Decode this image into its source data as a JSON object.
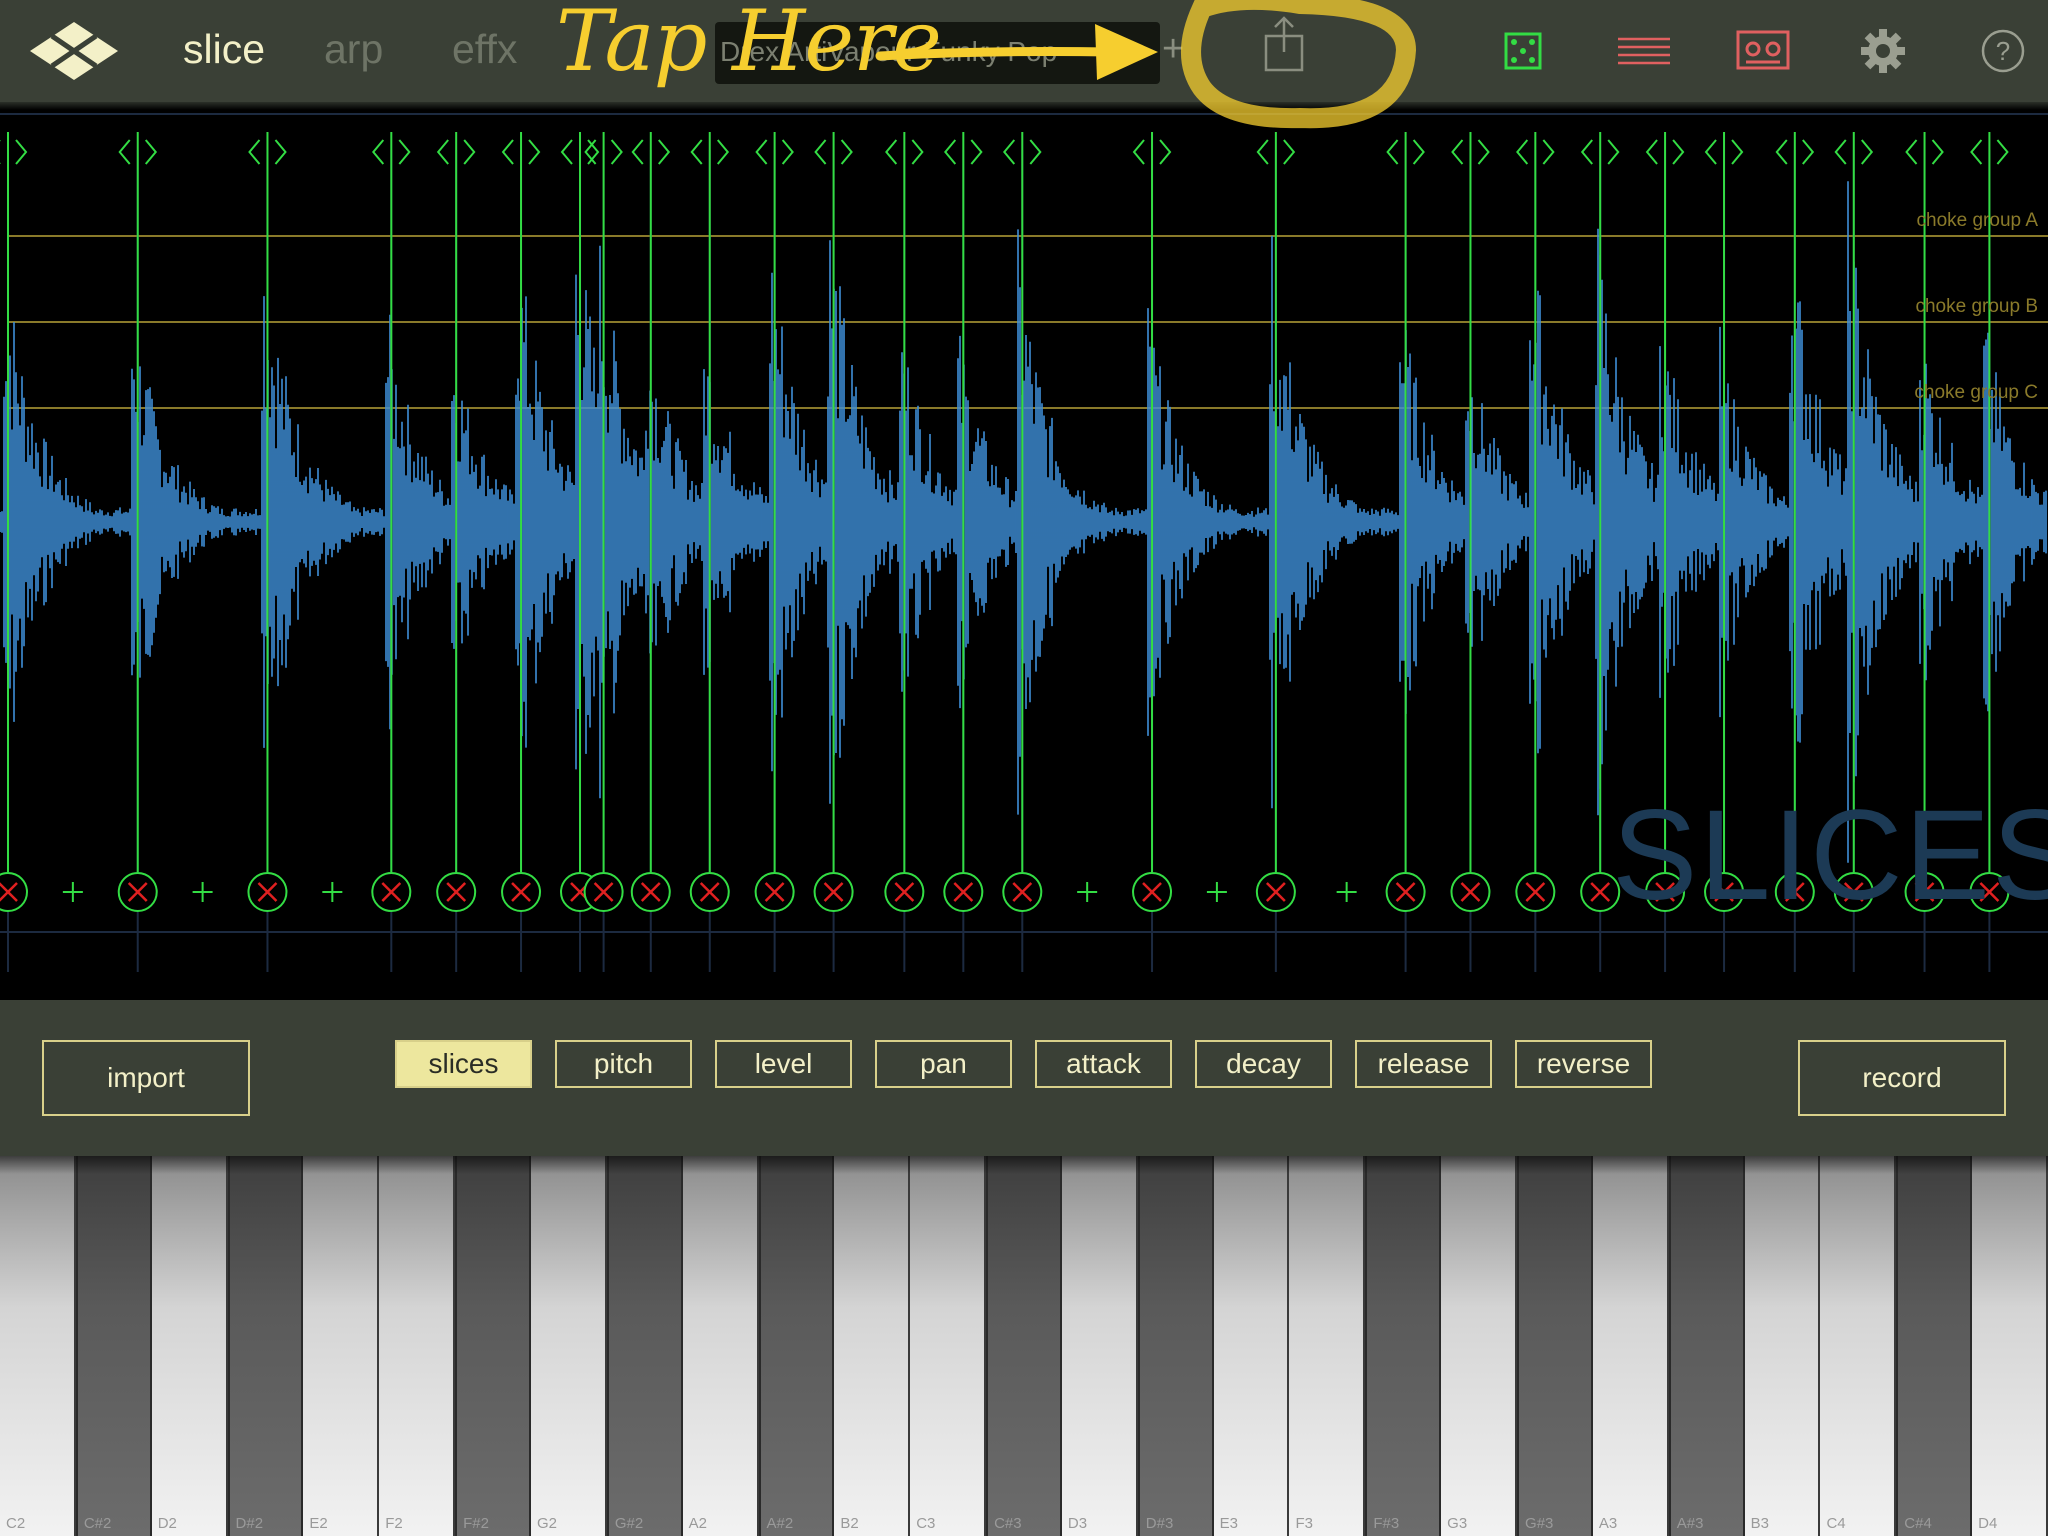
{
  "app": {
    "tabs": [
      {
        "label": "slice",
        "active": true
      },
      {
        "label": "arp",
        "active": false
      },
      {
        "label": "effx",
        "active": false
      }
    ],
    "preset_name": "Drex ArtiVapour Funky Pop",
    "preset_add_label": "+",
    "annotation": "Tap Here",
    "colors": {
      "panel_bg": "#3a4036",
      "accent_yellow": "#f6ce2f",
      "button_border": "#d8d08a",
      "slice_marker": "#33dd44",
      "delete_x": "#e02020",
      "waveform": "#3f8fd8",
      "choke_line": "#8a7a2a"
    },
    "icons": [
      "logo-icon",
      "share-icon",
      "dice-icon",
      "sequence-lines-icon",
      "cassette-icon",
      "gear-icon",
      "help-icon"
    ]
  },
  "waveform": {
    "choke_groups": [
      "choke group A",
      "choke group B",
      "choke group C"
    ],
    "watermark": "SLICES",
    "time_ticks": [
      "0.0",
      "0.2",
      "0.4",
      "0.6",
      "0.8",
      "1.0",
      "1.2",
      "1.4",
      "1.6",
      "1.8",
      "2.0",
      "2.2",
      "2.4",
      "2.6",
      "2.8",
      "3.0",
      "3.2",
      "3.4"
    ],
    "slices_seconds": [
      0.0,
      0.22,
      0.44,
      0.65,
      0.76,
      0.87,
      0.97,
      1.01,
      1.09,
      1.19,
      1.3,
      1.4,
      1.52,
      1.62,
      1.72,
      1.94,
      2.15,
      2.37,
      2.48,
      2.59,
      2.7,
      2.81,
      2.91,
      3.03,
      3.13,
      3.25,
      3.36
    ],
    "add_points_seconds": [
      0.11,
      0.33,
      0.55,
      1.83,
      2.05,
      2.27
    ]
  },
  "controls": {
    "import_label": "import",
    "record_label": "record",
    "modes": [
      {
        "label": "slices",
        "active": true
      },
      {
        "label": "pitch",
        "active": false
      },
      {
        "label": "level",
        "active": false
      },
      {
        "label": "pan",
        "active": false
      },
      {
        "label": "attack",
        "active": false
      },
      {
        "label": "decay",
        "active": false
      },
      {
        "label": "release",
        "active": false
      },
      {
        "label": "reverse",
        "active": false
      }
    ]
  },
  "keyboard": {
    "keys": [
      "C2",
      "C#2",
      "D2",
      "D#2",
      "E2",
      "F2",
      "F#2",
      "G2",
      "G#2",
      "A2",
      "A#2",
      "B2",
      "C3",
      "C#3",
      "D3",
      "D#3",
      "E3",
      "F3",
      "F#3",
      "G3",
      "G#3",
      "A3",
      "A#3",
      "B3",
      "C4",
      "C#4",
      "D4"
    ]
  }
}
